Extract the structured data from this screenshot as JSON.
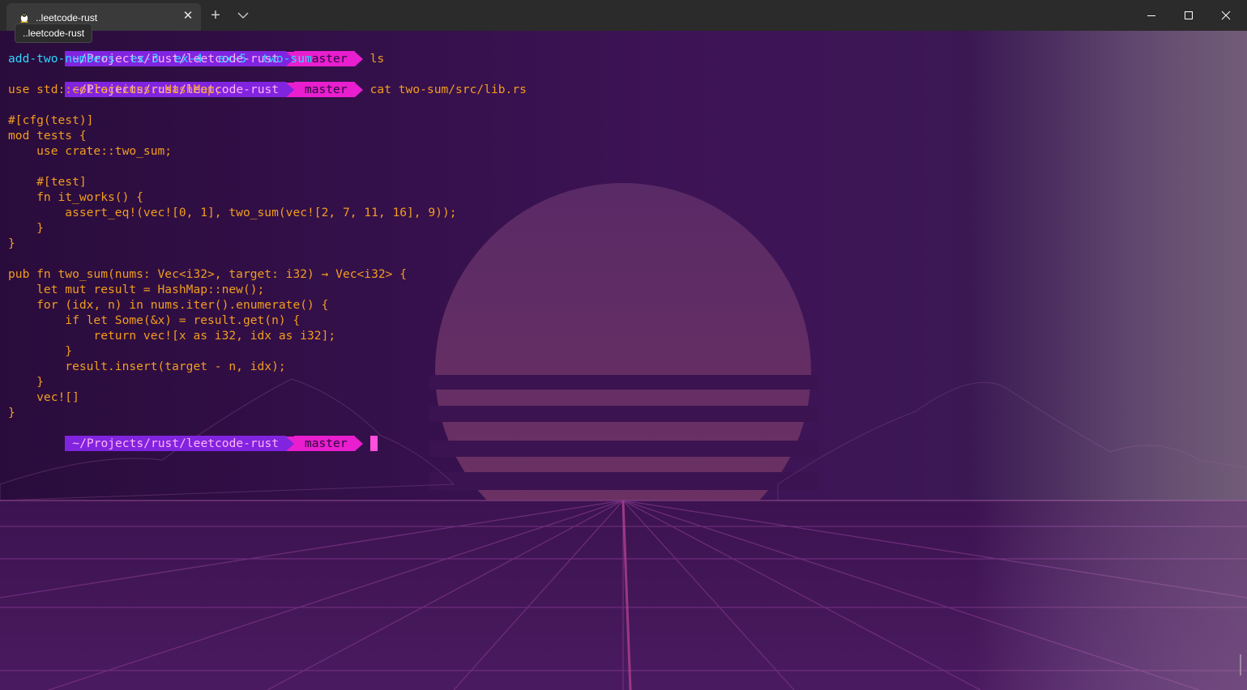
{
  "window": {
    "tab_title": "..leetcode-rust",
    "tooltip": "..leetcode-rust",
    "new_tab_label": "+",
    "close_tab_label": "✕",
    "icons": {
      "tab": "tux-linux-icon",
      "dropdown": "chevron-down-icon",
      "minimize": "minimize-icon",
      "maximize": "maximize-icon",
      "close": "close-icon"
    }
  },
  "prompt": {
    "path": "~/Projects/rust/leetcode-rust",
    "branch_icon": "",
    "branch": "master",
    "colors": {
      "path_bg": "#8024e0",
      "path_fg": "#ffb4f7",
      "branch_bg": "#e81ecf",
      "branch_fg": "#2a0a3a"
    }
  },
  "session": {
    "cmd1": "ls",
    "ls_output": [
      "add-two-numbers",
      "ex-3",
      "ex-4",
      "ex-5",
      "two-sum"
    ],
    "cmd2": "cat two-sum/src/lib.rs",
    "code_lines": [
      "use std::collections::HashMap;",
      "",
      "#[cfg(test)]",
      "mod tests {",
      "    use crate::two_sum;",
      "",
      "    #[test]",
      "    fn it_works() {",
      "        assert_eq!(vec![0, 1], two_sum(vec![2, 7, 11, 16], 9));",
      "    }",
      "}",
      "",
      "pub fn two_sum(nums: Vec<i32>, target: i32) → Vec<i32> {",
      "    let mut result = HashMap::new();",
      "    for (idx, n) in nums.iter().enumerate() {",
      "        if let Some(&x) = result.get(n) {",
      "            return vec![x as i32, idx as i32];",
      "        }",
      "        result.insert(target - n, idx);",
      "    }",
      "    vec![]",
      "}"
    ]
  },
  "colors": {
    "code": "#f29d1f",
    "ls_output": "#2fd7ff",
    "cursor": "#ff4fdc",
    "background": "#2a0c3e"
  }
}
